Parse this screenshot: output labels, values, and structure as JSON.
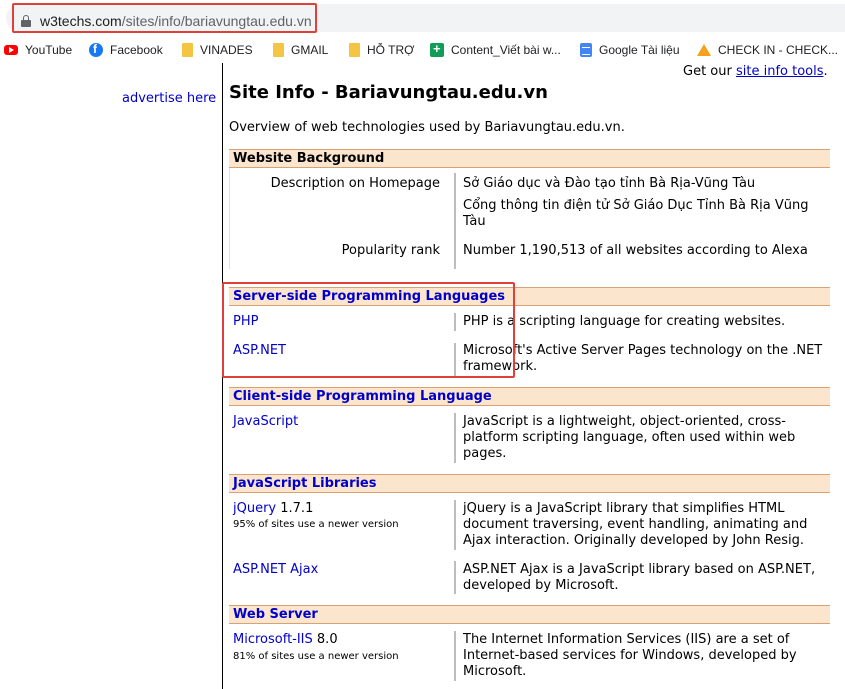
{
  "browser": {
    "url_host": "w3techs.com",
    "url_path": "/sites/info/bariavungtau.edu.vn",
    "bookmarks": [
      {
        "label": "YouTube",
        "icon": "youtube-icon"
      },
      {
        "label": "Facebook",
        "icon": "facebook-icon"
      },
      {
        "label": "VINADES",
        "icon": "folder-icon"
      },
      {
        "label": "GMAIL",
        "icon": "folder-icon"
      },
      {
        "label": "HỖ TRỢ",
        "icon": "folder-icon"
      },
      {
        "label": "Content_Viết bài w...",
        "icon": "sheets-icon"
      },
      {
        "label": "Google Tài liệu",
        "icon": "docs-icon"
      },
      {
        "label": "CHECK IN - CHECK...",
        "icon": "drive-icon"
      }
    ]
  },
  "sidebar": {
    "advertise": "advertise here"
  },
  "top_right": {
    "prefix": "Get our ",
    "link": "site info tools",
    "suffix": "."
  },
  "page": {
    "title": "Site Info - Bariavungtau.edu.vn",
    "overview": "Overview of web technologies used by Bariavungtau.edu.vn."
  },
  "sections": {
    "background": {
      "title": "Website Background",
      "description_label": "Description on Homepage",
      "description_1": "Sở Giáo dục và Đào tạo tỉnh Bà Rịa-Vũng Tàu",
      "description_2": "Cổng thông tin điện tử Sở Giáo Dục Tỉnh Bà Rịa Vũng Tàu",
      "popularity_label": "Popularity rank",
      "popularity_value": "Number 1,190,513 of all websites according to Alexa"
    },
    "server": {
      "title": "Server-side Programming Languages",
      "php": "PHP",
      "php_desc": "PHP is a scripting language for creating websites.",
      "aspnet": "ASP.NET",
      "aspnet_desc": "Microsoft's Active Server Pages technology on the .NET framework."
    },
    "client": {
      "title": "Client-side Programming Language",
      "js": "JavaScript",
      "js_desc": "JavaScript is a lightweight, object-oriented, cross-platform scripting language, often used within web pages."
    },
    "libraries": {
      "title": "JavaScript Libraries",
      "jquery": "jQuery",
      "jquery_version": " 1.7.1",
      "jquery_note": "95% of sites use a newer version",
      "jquery_desc": "jQuery is a JavaScript library that simplifies HTML document traversing, event handling, animating and Ajax interaction. Originally developed by John Resig.",
      "ajax": "ASP.NET Ajax",
      "ajax_desc": "ASP.NET Ajax is a JavaScript library based on ASP.NET, developed by Microsoft."
    },
    "webserver": {
      "title": "Web Server",
      "iis": "Microsoft-IIS",
      "iis_version": " 8.0",
      "iis_note": "81% of sites use a newer version",
      "iis_desc": "The Internet Information Services (IIS) are a set of Internet-based services for Windows, developed by Microsoft."
    }
  },
  "colors": {
    "section_bg": "#fce5cd",
    "link": "#0000cc",
    "highlight": "#e0403a"
  }
}
